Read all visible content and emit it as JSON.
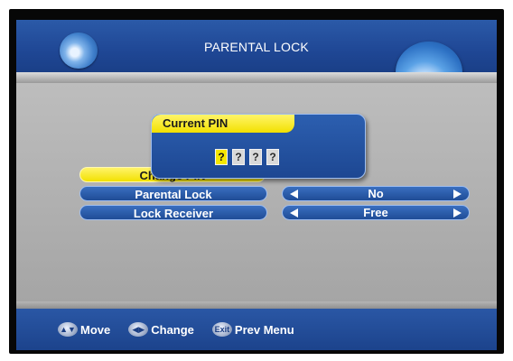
{
  "header": {
    "title": "PARENTAL LOCK"
  },
  "menu": {
    "highlighted_item": {
      "label": "Change PIN"
    },
    "items": [
      {
        "label": "Parental Lock",
        "value": "No"
      },
      {
        "label": "Lock Receiver",
        "value": "Free"
      }
    ]
  },
  "pin_dialog": {
    "title": "Current PIN",
    "digits": [
      "?",
      "?",
      "?",
      "?"
    ],
    "active_index": 0
  },
  "footer": {
    "hints": [
      {
        "icon": "updown-icon",
        "label": "Move"
      },
      {
        "icon": "leftright-icon",
        "label": "Change"
      },
      {
        "icon": "exit-icon",
        "icon_text": "Exit",
        "label": "Prev Menu"
      }
    ]
  },
  "colors": {
    "blue": "#1f4795",
    "yellow": "#f2e100",
    "panel_grey": "#a8a8a8"
  }
}
